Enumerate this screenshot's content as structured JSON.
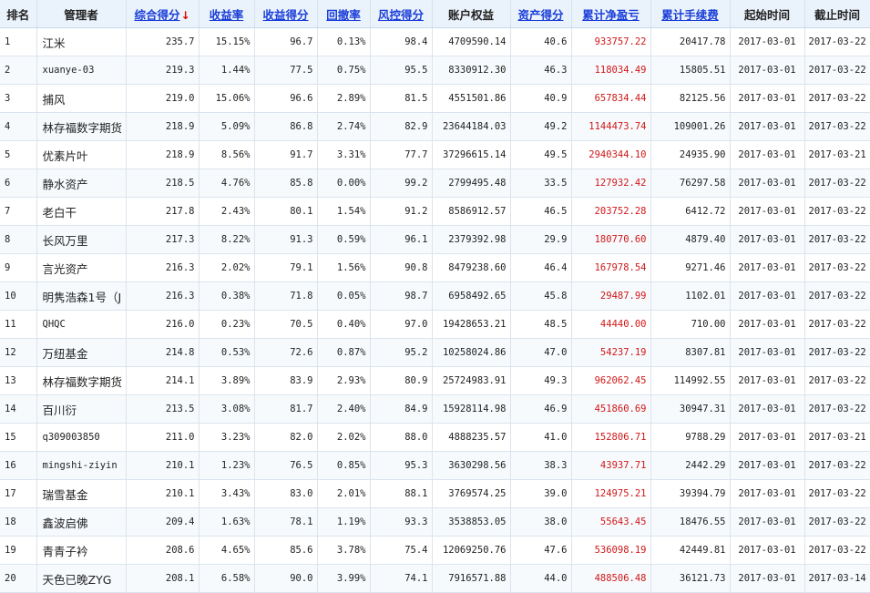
{
  "headers": [
    {
      "label": "排名",
      "sortable": false
    },
    {
      "label": "管理者",
      "sortable": false
    },
    {
      "label": "综合得分",
      "sortable": true,
      "arrow": "↓"
    },
    {
      "label": "收益率",
      "sortable": true
    },
    {
      "label": "收益得分",
      "sortable": true
    },
    {
      "label": "回撤率",
      "sortable": true
    },
    {
      "label": "风控得分",
      "sortable": true
    },
    {
      "label": "账户权益",
      "sortable": false
    },
    {
      "label": "资产得分",
      "sortable": true
    },
    {
      "label": "累计净盈亏",
      "sortable": true
    },
    {
      "label": "累计手续费",
      "sortable": true
    },
    {
      "label": "起始时间",
      "sortable": false
    },
    {
      "label": "截止时间",
      "sortable": false
    }
  ],
  "rows": [
    [
      "1",
      "江米",
      "235.7",
      "15.15%",
      "96.7",
      "0.13%",
      "98.4",
      "4709590.14",
      "40.6",
      "933757.22",
      "20417.78",
      "2017-03-01",
      "2017-03-22"
    ],
    [
      "2",
      "xuanye-03",
      "219.3",
      "1.44%",
      "77.5",
      "0.75%",
      "95.5",
      "8330912.30",
      "46.3",
      "118034.49",
      "15805.51",
      "2017-03-01",
      "2017-03-22"
    ],
    [
      "3",
      "捕风",
      "219.0",
      "15.06%",
      "96.6",
      "2.89%",
      "81.5",
      "4551501.86",
      "40.9",
      "657834.44",
      "82125.56",
      "2017-03-01",
      "2017-03-22"
    ],
    [
      "4",
      "林存福数字期货",
      "218.9",
      "5.09%",
      "86.8",
      "2.74%",
      "82.9",
      "23644184.03",
      "49.2",
      "1144473.74",
      "109001.26",
      "2017-03-01",
      "2017-03-22"
    ],
    [
      "5",
      "优素片叶",
      "218.9",
      "8.56%",
      "91.7",
      "3.31%",
      "77.7",
      "37296615.14",
      "49.5",
      "2940344.10",
      "24935.90",
      "2017-03-01",
      "2017-03-21"
    ],
    [
      "6",
      "静水资产",
      "218.5",
      "4.76%",
      "85.8",
      "0.00%",
      "99.2",
      "2799495.48",
      "33.5",
      "127932.42",
      "76297.58",
      "2017-03-01",
      "2017-03-22"
    ],
    [
      "7",
      "老白干",
      "217.8",
      "2.43%",
      "80.1",
      "1.54%",
      "91.2",
      "8586912.57",
      "46.5",
      "203752.28",
      "6412.72",
      "2017-03-01",
      "2017-03-22"
    ],
    [
      "8",
      "长风万里",
      "217.3",
      "8.22%",
      "91.3",
      "0.59%",
      "96.1",
      "2379392.98",
      "29.9",
      "180770.60",
      "4879.40",
      "2017-03-01",
      "2017-03-22"
    ],
    [
      "9",
      "言光资产",
      "216.3",
      "2.02%",
      "79.1",
      "1.56%",
      "90.8",
      "8479238.60",
      "46.4",
      "167978.54",
      "9271.46",
      "2017-03-01",
      "2017-03-22"
    ],
    [
      "10",
      "明隽浩森1号（J",
      "216.3",
      "0.38%",
      "71.8",
      "0.05%",
      "98.7",
      "6958492.65",
      "45.8",
      "29487.99",
      "1102.01",
      "2017-03-01",
      "2017-03-22"
    ],
    [
      "11",
      "QHQC",
      "216.0",
      "0.23%",
      "70.5",
      "0.40%",
      "97.0",
      "19428653.21",
      "48.5",
      "44440.00",
      "710.00",
      "2017-03-01",
      "2017-03-22"
    ],
    [
      "12",
      "万纽基金",
      "214.8",
      "0.53%",
      "72.6",
      "0.87%",
      "95.2",
      "10258024.86",
      "47.0",
      "54237.19",
      "8307.81",
      "2017-03-01",
      "2017-03-22"
    ],
    [
      "13",
      "林存福数字期货",
      "214.1",
      "3.89%",
      "83.9",
      "2.93%",
      "80.9",
      "25724983.91",
      "49.3",
      "962062.45",
      "114992.55",
      "2017-03-01",
      "2017-03-22"
    ],
    [
      "14",
      "百川衍",
      "213.5",
      "3.08%",
      "81.7",
      "2.40%",
      "84.9",
      "15928114.98",
      "46.9",
      "451860.69",
      "30947.31",
      "2017-03-01",
      "2017-03-22"
    ],
    [
      "15",
      "q309003850",
      "211.0",
      "3.23%",
      "82.0",
      "2.02%",
      "88.0",
      "4888235.57",
      "41.0",
      "152806.71",
      "9788.29",
      "2017-03-01",
      "2017-03-21"
    ],
    [
      "16",
      "mingshi-ziyin",
      "210.1",
      "1.23%",
      "76.5",
      "0.85%",
      "95.3",
      "3630298.56",
      "38.3",
      "43937.71",
      "2442.29",
      "2017-03-01",
      "2017-03-22"
    ],
    [
      "17",
      "瑞雪基金",
      "210.1",
      "3.43%",
      "83.0",
      "2.01%",
      "88.1",
      "3769574.25",
      "39.0",
      "124975.21",
      "39394.79",
      "2017-03-01",
      "2017-03-22"
    ],
    [
      "18",
      "鑫波启佛",
      "209.4",
      "1.63%",
      "78.1",
      "1.19%",
      "93.3",
      "3538853.05",
      "38.0",
      "55643.45",
      "18476.55",
      "2017-03-01",
      "2017-03-22"
    ],
    [
      "19",
      "青青子衿",
      "208.6",
      "4.65%",
      "85.6",
      "3.78%",
      "75.4",
      "12069250.76",
      "47.6",
      "536098.19",
      "42449.81",
      "2017-03-01",
      "2017-03-22"
    ],
    [
      "20",
      "天色已晚ZYG",
      "208.1",
      "6.58%",
      "90.0",
      "3.99%",
      "74.1",
      "7916571.88",
      "44.0",
      "488506.48",
      "36121.73",
      "2017-03-01",
      "2017-03-14"
    ]
  ],
  "colors": {
    "header_bg": "#eaf2fb",
    "sort_link": "#1a3ed8",
    "sort_arrow": "#e00000",
    "pnl_text": "#d01818"
  }
}
